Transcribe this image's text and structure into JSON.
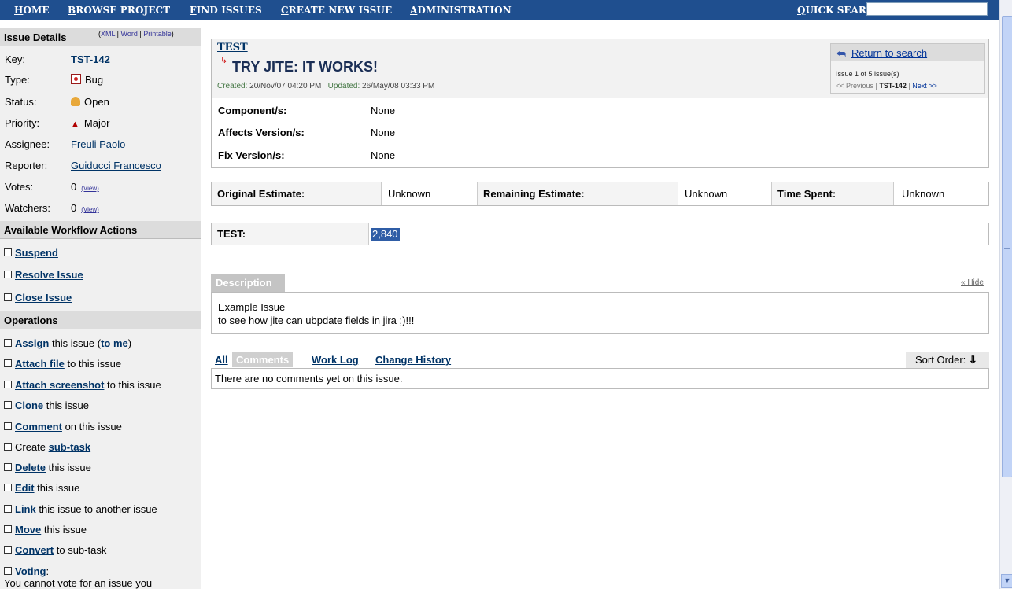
{
  "nav": {
    "items": [
      {
        "first": "H",
        "rest": "OME"
      },
      {
        "first": "B",
        "rest": "ROWSE PROJECT"
      },
      {
        "first": "F",
        "rest": "IND ISSUES"
      },
      {
        "first": "C",
        "rest": "REATE NEW ISSUE"
      },
      {
        "first": "A",
        "rest": "DMINISTRATION"
      }
    ],
    "quick_search_label": "QUICK SEARCH:",
    "quick_search_value": ""
  },
  "sidebar": {
    "details_heading": "Issue Details",
    "views": [
      "XML",
      "Word",
      "Printable"
    ],
    "key_label": "Key:",
    "key_value": "TST-142",
    "type_label": "Type:",
    "type_value": "Bug",
    "status_label": "Status:",
    "status_value": "Open",
    "priority_label": "Priority:",
    "priority_value": "Major",
    "assignee_label": "Assignee:",
    "assignee_value": "Freuli Paolo",
    "reporter_label": "Reporter:",
    "reporter_value": "Guiducci Francesco",
    "votes_label": "Votes:",
    "votes_value": "0",
    "watchers_label": "Watchers:",
    "watchers_value": "0",
    "view_link": "(View)",
    "workflow_heading": "Available Workflow Actions",
    "workflow_actions": [
      "Suspend",
      "Resolve Issue",
      "Close Issue"
    ],
    "operations_heading": "Operations",
    "operations": [
      {
        "link": "Assign",
        "text": " this issue (",
        "link2": "to me",
        "text2": ")"
      },
      {
        "link": "Attach file",
        "text": " to this issue"
      },
      {
        "link": "Attach screenshot",
        "text": " to this issue"
      },
      {
        "link": "Clone",
        "text": " this issue"
      },
      {
        "link": "Comment",
        "text": " on this issue"
      },
      {
        "prefix": "Create ",
        "link": "sub-task",
        "text": ""
      },
      {
        "link": "Delete",
        "text": " this issue"
      },
      {
        "link": "Edit",
        "text": " this issue"
      },
      {
        "link": "Link",
        "text": " this issue to another issue"
      },
      {
        "link": "Move",
        "text": " this issue"
      },
      {
        "link": "Convert",
        "text": " to sub-task"
      },
      {
        "link": "Voting",
        "text": ":"
      }
    ],
    "voting_note": "You cannot vote for an issue you"
  },
  "issue": {
    "project": "TEST",
    "title": "TRY JITE: IT WORKS!",
    "created_label": "Created:",
    "created": "20/Nov/07 04:20 PM",
    "updated_label": "Updated:",
    "updated": "26/May/08 03:33 PM",
    "return_link": "Return to search",
    "nav_count": "Issue 1 of 5 issue(s)",
    "nav_prev": "<< Previous",
    "nav_current": "TST-142",
    "nav_next": "Next >>",
    "fields": [
      {
        "label": "Component/s:",
        "value": "None"
      },
      {
        "label": "Affects Version/s:",
        "value": "None"
      },
      {
        "label": "Fix Version/s:",
        "value": "None"
      }
    ]
  },
  "time_tracking": {
    "original_label": "Original Estimate:",
    "original_value": "Unknown",
    "remaining_label": "Remaining Estimate:",
    "remaining_value": "Unknown",
    "spent_label": "Time Spent:",
    "spent_value": "Unknown"
  },
  "custom_field": {
    "label": "TEST:",
    "value": "2,840"
  },
  "description": {
    "tab": "Description",
    "hide": "« Hide",
    "line1": "Example Issue",
    "line2": "to see how jite can ubpdate fields in jira ;)!!!"
  },
  "activity": {
    "tabs": [
      "All",
      "Comments",
      "Work Log",
      "Change History"
    ],
    "active_tab": "Comments",
    "sort_label": "Sort Order:",
    "empty_text": "There are no comments yet on this issue."
  },
  "colors": {
    "nav_bg": "#1f4f8f",
    "link": "#003366",
    "selection": "#2f5da6"
  }
}
